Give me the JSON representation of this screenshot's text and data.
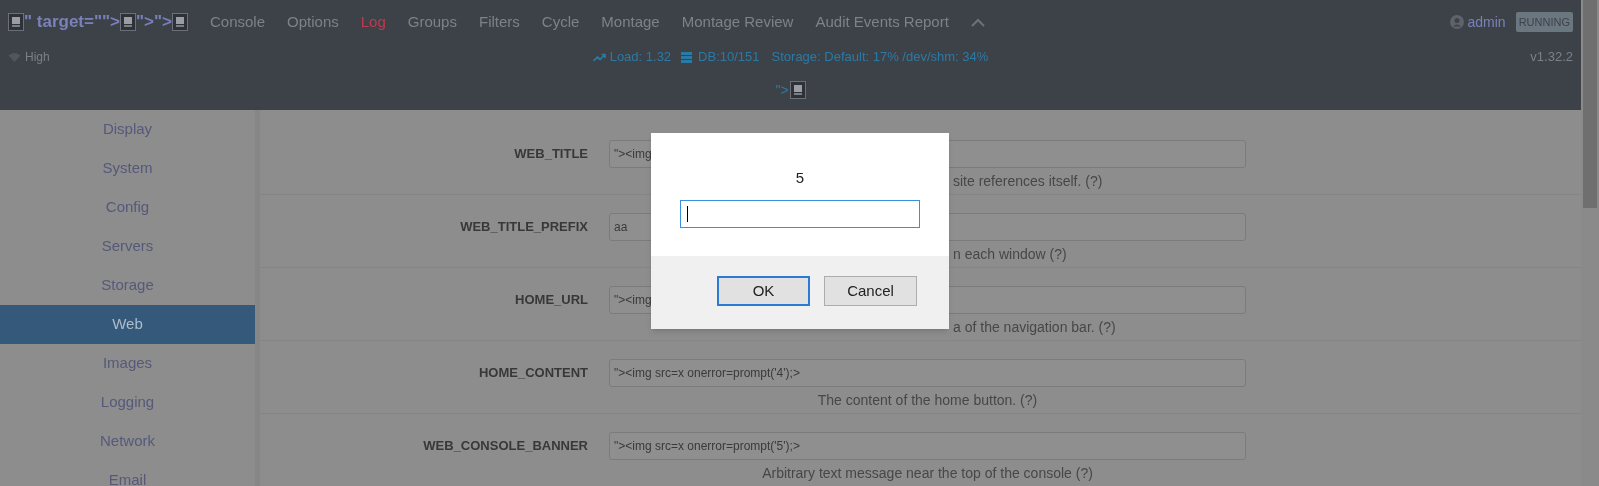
{
  "header": {
    "brand": [
      {
        "kind": "image"
      },
      {
        "kind": "text",
        "text": "\" target=\"\">"
      },
      {
        "kind": "image"
      },
      {
        "kind": "text",
        "text": "\">\">"
      },
      {
        "kind": "image"
      }
    ],
    "nav": [
      {
        "label": "Console"
      },
      {
        "label": "Options"
      },
      {
        "label": "Log",
        "color": "#c0394e"
      },
      {
        "label": "Groups"
      },
      {
        "label": "Filters"
      },
      {
        "label": "Cycle"
      },
      {
        "label": "Montage"
      },
      {
        "label": "Montage Review"
      },
      {
        "label": "Audit Events Report"
      }
    ],
    "user": "admin",
    "status": "RUNNING",
    "signal": "High",
    "load": "Load: 1.32",
    "db": "DB:10/151",
    "storage": "Storage: Default: 17% /dev/shm: 34%",
    "version": "v1.32.2",
    "banner": "\">"
  },
  "sidebar": {
    "items": [
      {
        "label": "Display",
        "selected": false
      },
      {
        "label": "System",
        "selected": false
      },
      {
        "label": "Config",
        "selected": false
      },
      {
        "label": "Servers",
        "selected": false
      },
      {
        "label": "Storage",
        "selected": false
      },
      {
        "label": "Web",
        "selected": true
      },
      {
        "label": "Images",
        "selected": false
      },
      {
        "label": "Logging",
        "selected": false
      },
      {
        "label": "Network",
        "selected": false
      },
      {
        "label": "Email",
        "selected": false
      }
    ]
  },
  "settings": [
    {
      "name": "WEB_TITLE",
      "value": "\"><img",
      "description": "site references itself. (?)",
      "cut": true
    },
    {
      "name": "WEB_TITLE_PREFIX",
      "value": "aa",
      "description": "n each window (?)",
      "cut": true
    },
    {
      "name": "HOME_URL",
      "value": "\"><img",
      "description": "a of the navigation bar. (?)",
      "cut": true
    },
    {
      "name": "HOME_CONTENT",
      "value": "\"><img src=x onerror=prompt('4');>",
      "description": "The content of the home button. (?)",
      "cut": false
    },
    {
      "name": "WEB_CONSOLE_BANNER",
      "value": "\"><img src=x onerror=prompt('5');>",
      "description": "Arbitrary text message near the top of the console (?)",
      "cut": false
    }
  ],
  "dialog": {
    "message": "5",
    "buttons": [
      {
        "label": "OK",
        "kind": "primary"
      },
      {
        "label": "Cancel",
        "kind": "secondary"
      }
    ]
  }
}
